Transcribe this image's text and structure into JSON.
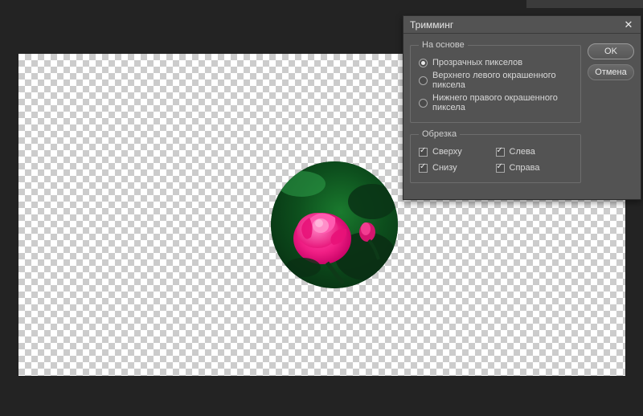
{
  "dialog": {
    "title": "Тримминг",
    "buttons": {
      "ok": "OK",
      "cancel": "Отмена"
    },
    "based_on": {
      "legend": "На основе",
      "opt_transparent": "Прозрачных пикселов",
      "opt_top_left": "Верхнего левого окрашенного пиксела",
      "opt_bottom_right": "Нижнего правого окрашенного пиксела",
      "selected": "transparent"
    },
    "trim": {
      "legend": "Обрезка",
      "top": "Сверху",
      "bottom": "Снизу",
      "left": "Слева",
      "right": "Справа",
      "top_checked": true,
      "bottom_checked": true,
      "left_checked": true,
      "right_checked": true
    }
  }
}
